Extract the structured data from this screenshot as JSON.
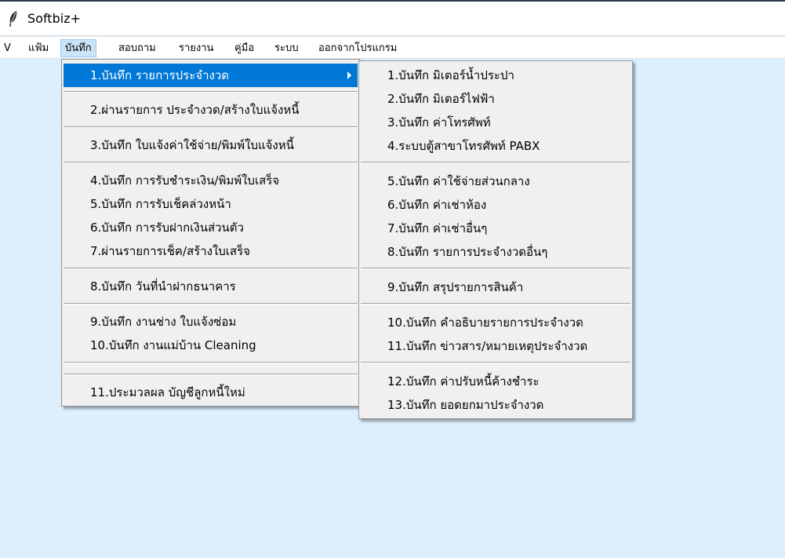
{
  "window": {
    "title": "Softbiz+",
    "icon": "feather-icon"
  },
  "menubar": {
    "items": [
      {
        "label": "V"
      },
      {
        "label": "แฟ้ม"
      },
      {
        "label": "บันทึก"
      },
      {
        "label": "สอบถาม"
      },
      {
        "label": "รายงาน"
      },
      {
        "label": "คู่มือ"
      },
      {
        "label": "ระบบ"
      },
      {
        "label": "ออกจากโปรแกรม"
      }
    ],
    "active": "บันทึก"
  },
  "menu1": {
    "items": [
      {
        "label": "1.บันทึก รายการประจำงวด"
      },
      {
        "label": "2.ผ่านรายการ ประจำงวด/สร้างใบแจ้งหนี้"
      },
      {
        "label": "3.บันทึก ใบแจ้งค่าใช้จ่าย/พิมพ์ใบแจ้งหนี้"
      },
      {
        "label": "4.บันทึก การรับชำระเงิน/พิมพ์ใบเสร็จ"
      },
      {
        "label": "5.บันทึก การรับเช็คล่วงหน้า"
      },
      {
        "label": "6.บันทึก การรับฝากเงินส่วนตัว"
      },
      {
        "label": "7.ผ่านรายการเช็ค/สร้างใบเสร็จ"
      },
      {
        "label": "8.บันทึก วันที่นำฝากธนาคาร"
      },
      {
        "label": "9.บันทึก งานช่าง ใบแจ้งซ่อม"
      },
      {
        "label": "10.บันทึก งานแม่บ้าน Cleaning"
      },
      {
        "label": "11.ประมวลผล บัญชีลูกหนี้ใหม่"
      }
    ]
  },
  "menu2": {
    "items": [
      {
        "label": "1.บันทึก มิเตอร์น้ำประปา"
      },
      {
        "label": "2.บันทึก มิเตอร์ไฟฟ้า"
      },
      {
        "label": "3.บันทึก ค่าโทรศัพท์"
      },
      {
        "label": "4.ระบบตู้สาขาโทรศัพท์ PABX"
      },
      {
        "label": "5.บันทึก ค่าใช้จ่ายส่วนกลาง"
      },
      {
        "label": "6.บันทึก ค่าเช่าห้อง"
      },
      {
        "label": "7.บันทึก ค่าเช่าอื่นๆ"
      },
      {
        "label": "8.บันทึก รายการประจำงวดอื่นๆ"
      },
      {
        "label": "9.บันทึก สรุปรายการสินค้า"
      },
      {
        "label": "10.บันทึก คำอธิบายรายการประจำงวด"
      },
      {
        "label": "11.บันทึก ข่าวสาร/หมายเหตุประจำงวด"
      },
      {
        "label": "12.บันทึก ค่าปรับหนี้ค้างชำระ"
      },
      {
        "label": "13.บันทึก ยอดยกมาประจำงวด"
      }
    ]
  },
  "colors": {
    "background": "#ddeefc",
    "highlight": "#0078d7",
    "menu_bg": "#f0f0f0",
    "menubar_active": "#cce4f7"
  }
}
